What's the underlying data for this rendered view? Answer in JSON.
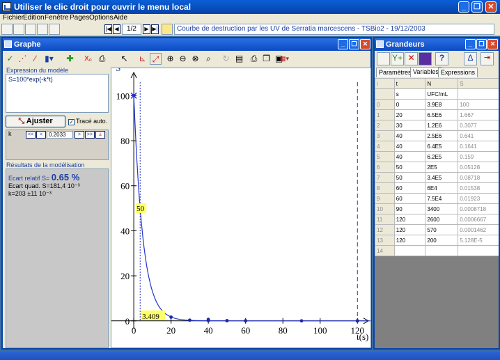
{
  "window": {
    "title": "Utiliser le clic droit pour ouvrir le menu local"
  },
  "menu": {
    "items": [
      "Fichier",
      "Edition",
      "Fenêtre",
      "Pages",
      "Options",
      "Aide"
    ]
  },
  "toolbar": {
    "page_indicator": "1/2",
    "document_title": "Courbe de destruction par les UV de Serratia marcescens - TSBio2 - 19/12/2003"
  },
  "graphe": {
    "title": "Graphe",
    "expression_label": "Expression du modèle",
    "expression": "S=100*exp(-k*t)",
    "ajuster_label": "Ajuster",
    "trace_auto_label": "Tracé auto.",
    "param_name": "k",
    "param_value": "0.2033",
    "results_label": "Résultats de la modélisation",
    "ecart_relatif_label": "Ecart relatif S=",
    "ecart_relatif_value": "0.65 %",
    "ecart_quad": "Ecart quad. S=181,4 10⁻³",
    "k_result": "k=203 ±11 10⁻³"
  },
  "chart_data": {
    "type": "scatter",
    "ylabel": "S",
    "xlabel": "t(s)",
    "xlim": [
      -12,
      127
    ],
    "ylim": [
      -1,
      106
    ],
    "xticks": [
      0,
      20,
      40,
      60,
      80,
      100,
      120
    ],
    "yticks": [
      0,
      20,
      40,
      60,
      80,
      100
    ],
    "points": [
      {
        "x": 0,
        "y": 100
      },
      {
        "x": 20,
        "y": 1.667
      },
      {
        "x": 30,
        "y": 0.3077
      },
      {
        "x": 40,
        "y": 0.641
      },
      {
        "x": 40,
        "y": 0.1641
      },
      {
        "x": 40,
        "y": 0.159
      },
      {
        "x": 50,
        "y": 0.05128
      },
      {
        "x": 50,
        "y": 0.08718
      },
      {
        "x": 60,
        "y": 0.01538
      },
      {
        "x": 60,
        "y": 0.01923
      },
      {
        "x": 90,
        "y": 0.0008718
      },
      {
        "x": 120,
        "y": 0.0006667
      },
      {
        "x": 120,
        "y": 0.0001462
      },
      {
        "x": 120,
        "y": 5.128e-05
      }
    ],
    "model": {
      "expression": "S=100*exp(-k*t)",
      "k": 0.2033
    },
    "cursor_label_upper": "50",
    "cursor_label_lower": "3.409",
    "cursor_x": 3.409
  },
  "grandeurs": {
    "title": "Grandeurs",
    "tabs": [
      "Paramètres",
      "Variables",
      "Expressions"
    ],
    "active_tab": "Variables",
    "columns": [
      "i",
      "t",
      "N",
      "S"
    ],
    "units": [
      "",
      "s",
      "UFC/mL",
      ""
    ],
    "rows": [
      [
        "0",
        "0",
        "3.9E8",
        "100"
      ],
      [
        "1",
        "20",
        "6.5E6",
        "1.667"
      ],
      [
        "2",
        "30",
        "1.2E6",
        "0.3077"
      ],
      [
        "3",
        "40",
        "2.5E6",
        "0.641"
      ],
      [
        "4",
        "40",
        "6.4E5",
        "0.1641"
      ],
      [
        "5",
        "40",
        "6.2E5",
        "0.159"
      ],
      [
        "6",
        "50",
        "2E5",
        "0.05128"
      ],
      [
        "7",
        "50",
        "3.4E5",
        "0.08718"
      ],
      [
        "8",
        "60",
        "6E4",
        "0.01538"
      ],
      [
        "9",
        "60",
        "7.5E4",
        "0.01923"
      ],
      [
        "10",
        "90",
        "3400",
        "0.0008718"
      ],
      [
        "11",
        "120",
        "2600",
        "0.0006667"
      ],
      [
        "12",
        "120",
        "570",
        "0.0001462"
      ],
      [
        "13",
        "120",
        "200",
        "5.128E-5"
      ],
      [
        "14",
        "",
        "",
        ""
      ]
    ]
  }
}
